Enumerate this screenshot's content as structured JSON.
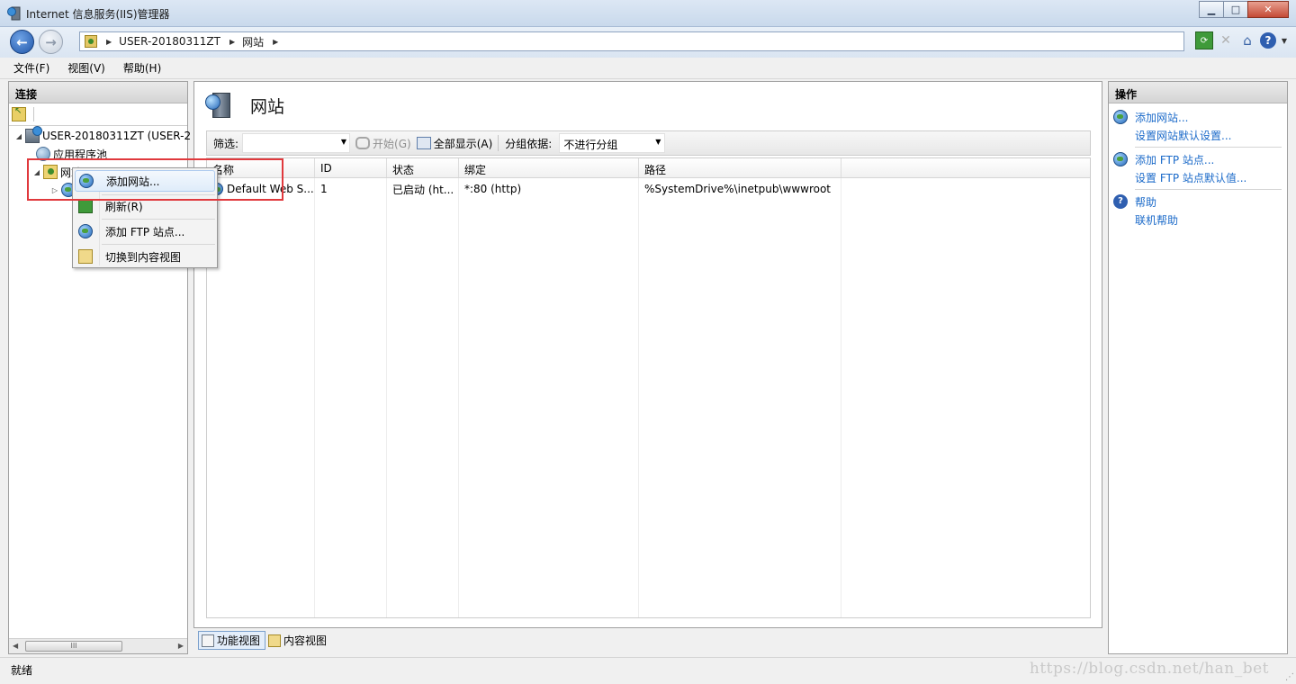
{
  "window": {
    "title": "Internet 信息服务(IIS)管理器",
    "minimize": "▁",
    "maximize": "□",
    "close": "✕"
  },
  "nav": {
    "breadcrumb": [
      "USER-20180311ZT",
      "网站"
    ]
  },
  "menu": [
    "文件(F)",
    "视图(V)",
    "帮助(H)"
  ],
  "connections": {
    "header": "连接",
    "tree": [
      {
        "label": "USER-20180311ZT (USER-2",
        "icon": "server-icon"
      },
      {
        "label": "应用程序池",
        "icon": "app-pool-icon"
      },
      {
        "label": "网站",
        "icon": "sites-folder-icon"
      },
      {
        "label": "",
        "icon": "globe-icon"
      }
    ]
  },
  "center": {
    "title": "网站",
    "filter_label": "筛选:",
    "start_label": "开始(G)",
    "show_all_label": "全部显示(A)",
    "group_by_label": "分组依据:",
    "group_value": "不进行分组",
    "columns": [
      "名称",
      "ID",
      "状态",
      "绑定",
      "路径"
    ],
    "rows": [
      {
        "name": "Default Web S...",
        "id": "1",
        "status": "已启动 (ht...",
        "binding": "*:80 (http)",
        "path": "%SystemDrive%\\inetpub\\wwwroot"
      }
    ],
    "view_tabs": [
      "功能视图",
      "内容视图"
    ]
  },
  "actions": {
    "header": "操作",
    "items": [
      {
        "label": "添加网站...",
        "icon": "add-site-icon"
      },
      {
        "label": "设置网站默认设置...",
        "icon": ""
      },
      {
        "label": "添加 FTP 站点...",
        "icon": "add-ftp-icon"
      },
      {
        "label": "设置 FTP 站点默认值...",
        "icon": ""
      },
      {
        "label": "帮助",
        "icon": "help-icon"
      },
      {
        "label": "联机帮助",
        "icon": ""
      }
    ]
  },
  "context_menu": [
    "添加网站...",
    "刷新(R)",
    "添加 FTP 站点...",
    "切换到内容视图"
  ],
  "status": {
    "text": "就绪",
    "watermark": "https://blog.csdn.net/han_bet"
  },
  "colors": {
    "link": "#1b6ac9",
    "highlight": "#e0393d"
  }
}
